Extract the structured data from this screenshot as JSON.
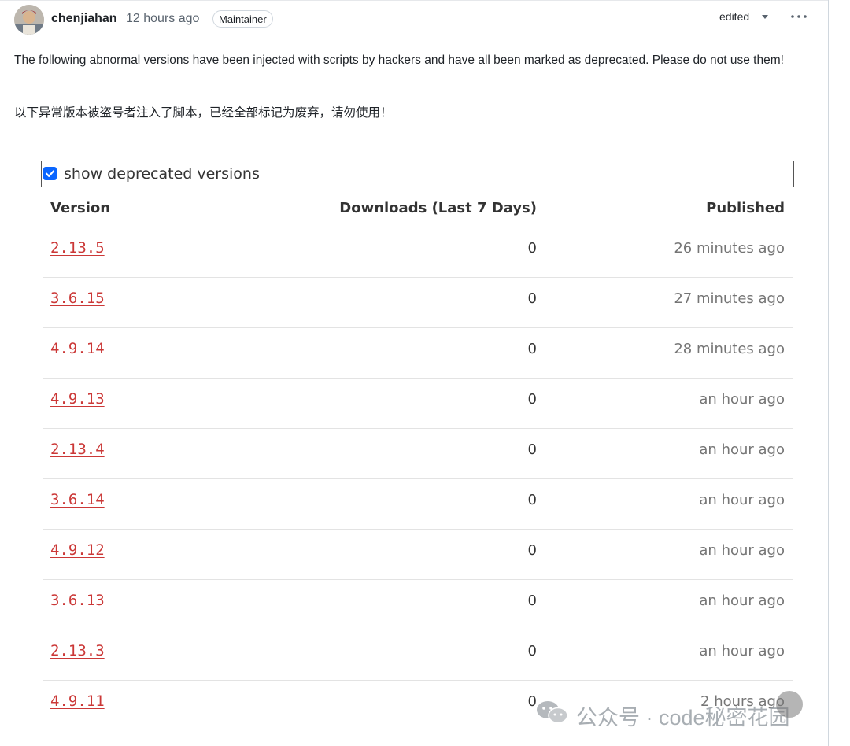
{
  "comment": {
    "author": "chenjiahan",
    "timestamp": "12 hours ago",
    "badge": "Maintainer",
    "edited_label": "edited",
    "body_en": "The following abnormal versions have been injected with scripts by hackers and have all been marked as deprecated. Please do not use them!",
    "body_zh": "以下异常版本被盗号者注入了脚本，已经全部标记为废弃，请勿使用！"
  },
  "versions_panel": {
    "filter_label": "show deprecated versions",
    "filter_checked": true,
    "headers": {
      "version": "Version",
      "downloads": "Downloads (Last 7 Days)",
      "published": "Published"
    },
    "rows": [
      {
        "version": "2.13.5",
        "downloads": "0",
        "published": "26 minutes ago"
      },
      {
        "version": "3.6.15",
        "downloads": "0",
        "published": "27 minutes ago"
      },
      {
        "version": "4.9.14",
        "downloads": "0",
        "published": "28 minutes ago"
      },
      {
        "version": "4.9.13",
        "downloads": "0",
        "published": "an hour ago"
      },
      {
        "version": "2.13.4",
        "downloads": "0",
        "published": "an hour ago"
      },
      {
        "version": "3.6.14",
        "downloads": "0",
        "published": "an hour ago"
      },
      {
        "version": "4.9.12",
        "downloads": "0",
        "published": "an hour ago"
      },
      {
        "version": "3.6.13",
        "downloads": "0",
        "published": "an hour ago"
      },
      {
        "version": "2.13.3",
        "downloads": "0",
        "published": "an hour ago"
      },
      {
        "version": "4.9.11",
        "downloads": "0",
        "published": "2 hours ago"
      }
    ]
  },
  "watermark": {
    "text": "公众号 · code秘密花园"
  },
  "colors": {
    "version_link": "#cb3837",
    "checkbox": "#0a66ff",
    "muted_text": "#757575"
  }
}
